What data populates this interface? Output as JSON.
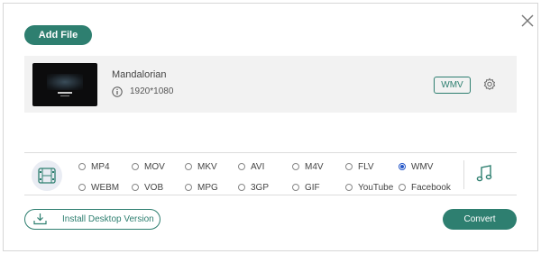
{
  "toolbar": {
    "add_file_label": "Add File"
  },
  "file": {
    "name": "Mandalorian",
    "resolution": "1920*1080",
    "output_format": "WMV"
  },
  "formats": [
    {
      "label": "MP4",
      "selected": false
    },
    {
      "label": "MOV",
      "selected": false
    },
    {
      "label": "MKV",
      "selected": false
    },
    {
      "label": "AVI",
      "selected": false
    },
    {
      "label": "M4V",
      "selected": false
    },
    {
      "label": "FLV",
      "selected": false
    },
    {
      "label": "WMV",
      "selected": true
    },
    {
      "label": "WEBM",
      "selected": false
    },
    {
      "label": "VOB",
      "selected": false
    },
    {
      "label": "MPG",
      "selected": false
    },
    {
      "label": "3GP",
      "selected": false
    },
    {
      "label": "GIF",
      "selected": false
    },
    {
      "label": "YouTube",
      "selected": false
    },
    {
      "label": "Facebook",
      "selected": false
    }
  ],
  "footer": {
    "install_label": "Install Desktop Version",
    "convert_label": "Convert"
  },
  "colors": {
    "accent": "#2e7f70",
    "radio_selected": "#2456c8"
  },
  "icons": [
    "close-icon",
    "info-icon",
    "gear-icon",
    "video-icon",
    "music-icon",
    "download-icon"
  ]
}
